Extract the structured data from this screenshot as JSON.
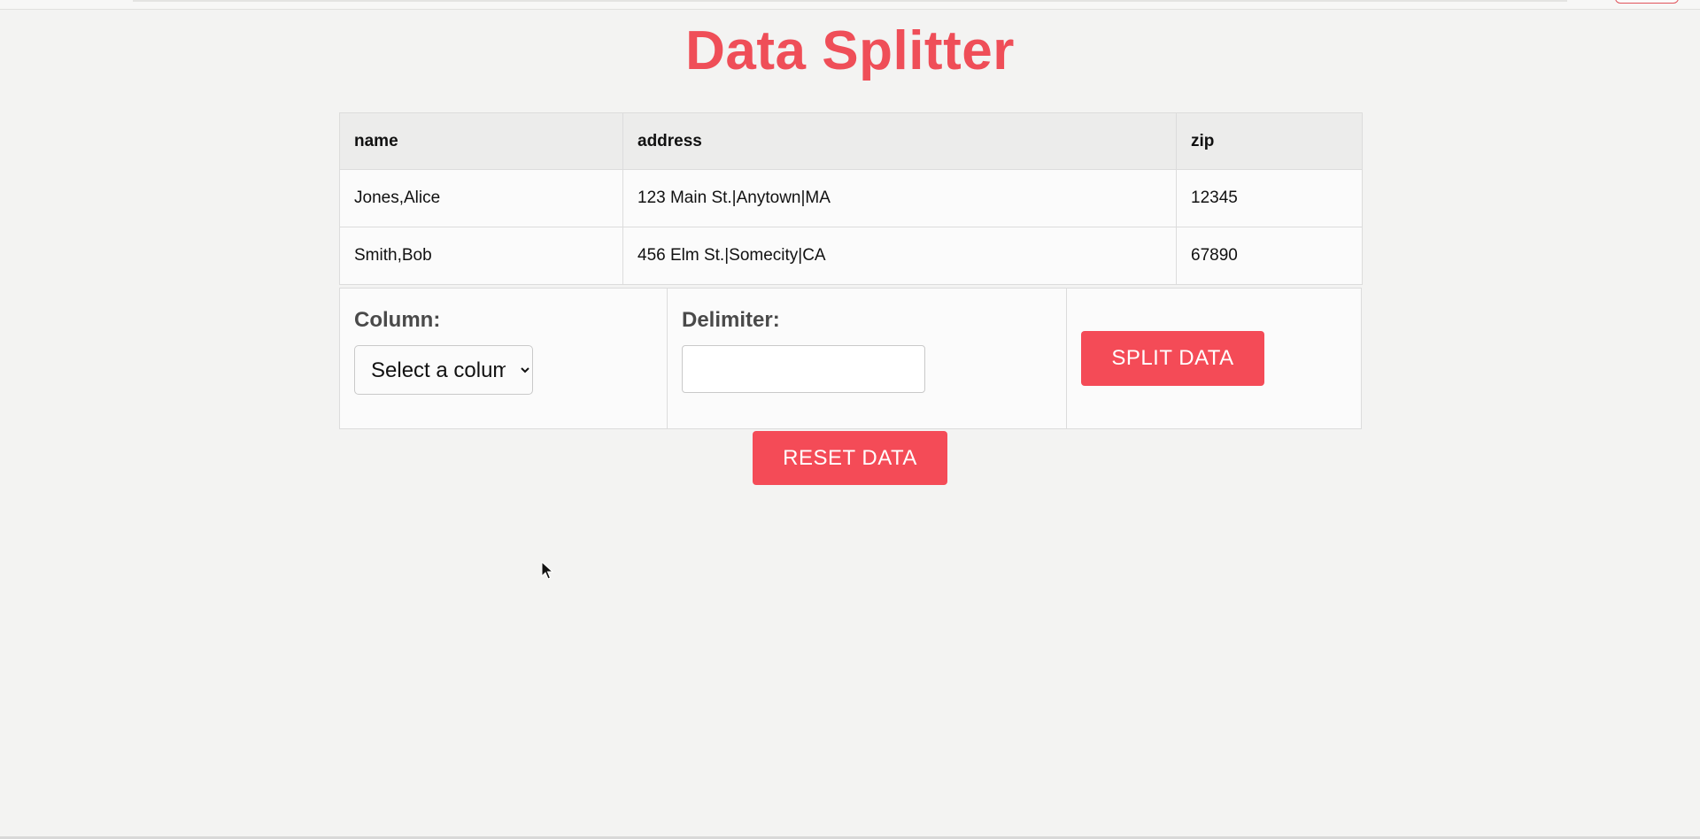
{
  "page": {
    "title": "Data Splitter"
  },
  "table": {
    "headers": [
      "name",
      "address",
      "zip"
    ],
    "rows": [
      [
        "Jones,Alice",
        "123 Main St.|Anytown|MA",
        "12345"
      ],
      [
        "Smith,Bob",
        "456 Elm St.|Somecity|CA",
        "67890"
      ]
    ]
  },
  "controls": {
    "column_label": "Column:",
    "column_select_value": "Select a column",
    "delimiter_label": "Delimiter:",
    "delimiter_value": "",
    "split_button": "SPLIT DATA",
    "reset_button": "RESET DATA"
  },
  "colors": {
    "accent": "#f44b57",
    "title": "#ef4e58",
    "background": "#f3f3f2"
  },
  "icons": {
    "cursor": "mouse-pointer-icon",
    "select_arrow": "chevron-down-icon"
  }
}
